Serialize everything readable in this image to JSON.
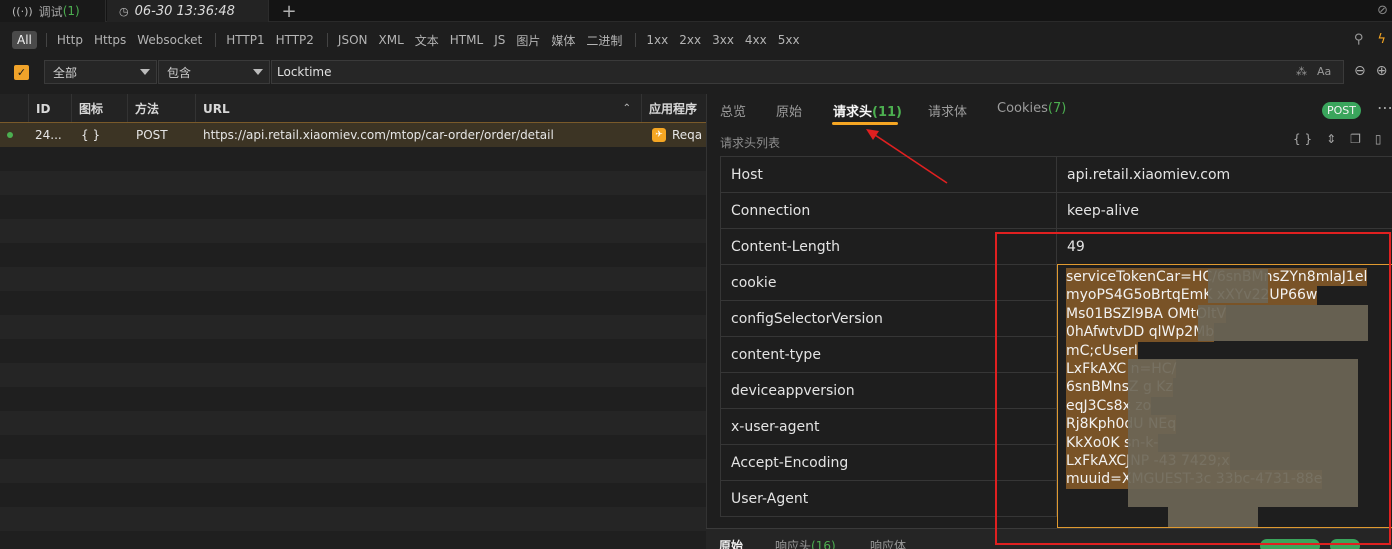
{
  "tabs": {
    "debug": {
      "label": "调试",
      "count": "(1)"
    },
    "session": {
      "label": "06-30 13:36:48"
    },
    "add": "+"
  },
  "filter_types": [
    "All",
    "Http",
    "Https",
    "Websocket",
    "HTTP1",
    "HTTP2",
    "JSON",
    "XML",
    "文本",
    "HTML",
    "JS",
    "图片",
    "媒体",
    "二进制",
    "1xx",
    "2xx",
    "3xx",
    "4xx",
    "5xx"
  ],
  "search": {
    "scope": "全部",
    "operator": "包含",
    "value": "Locktime",
    "case_label": "Aa"
  },
  "table": {
    "columns": [
      "ID",
      "图标",
      "方法",
      "URL",
      "应用程序"
    ],
    "rows": [
      {
        "id": "24...",
        "icon": "{ }",
        "method": "POST",
        "url": "https://api.retail.xiaomiev.com/mtop/car-order/order/detail",
        "app": "Reqa"
      }
    ]
  },
  "detail": {
    "tabs": [
      {
        "label": "总览",
        "count": ""
      },
      {
        "label": "原始",
        "count": ""
      },
      {
        "label": "请求头",
        "count": "(11)"
      },
      {
        "label": "请求体",
        "count": ""
      },
      {
        "label": "Cookies",
        "count": "(7)"
      }
    ],
    "method_badge": "POST",
    "list_label": "请求头列表",
    "headers": [
      {
        "key": "Host",
        "value": "api.retail.xiaomiev.com"
      },
      {
        "key": "Connection",
        "value": "keep-alive"
      },
      {
        "key": "Content-Length",
        "value": "49"
      },
      {
        "key": "cookie",
        "value": ""
      },
      {
        "key": "configSelectorVersion",
        "value": ""
      },
      {
        "key": "content-type",
        "value": ""
      },
      {
        "key": "deviceappversion",
        "value": ""
      },
      {
        "key": "x-user-agent",
        "value": ""
      },
      {
        "key": "Accept-Encoding",
        "value": ""
      },
      {
        "key": "User-Agent",
        "value": ""
      }
    ],
    "cookie_lines": [
      "serviceTokenCar=HC/6snBMnsZYn8mlaJ1el",
      "myoPS4G5oBrtqEmK          xXYv22UP66w",
      "Ms01BSZl9BA                  OMtOltV",
      "0hAfwtvDD                      qlWp2Mb",
      "mC;cUserI",
      "LxFkAXC                           n=HC/",
      "6snBMnsZ                           g   Kz",
      "eqJ3Cs8x                              zo",
      "Rj8Kph0dU                          NEq",
      "KkXo0K                             sn-k-",
      "LxFkAXCJNP                    -43 7429;x",
      "muuid=XMGUEST-3c          33bc-4731-88e"
    ]
  },
  "bottom": {
    "tabs": [
      {
        "label": "原始",
        "count": ""
      },
      {
        "label": "响应头",
        "count": "(16)"
      },
      {
        "label": "响应体",
        "count": ""
      }
    ]
  },
  "colors": {
    "accent": "#f5a623",
    "success": "#3aa55c",
    "annotation": "#e02020"
  }
}
